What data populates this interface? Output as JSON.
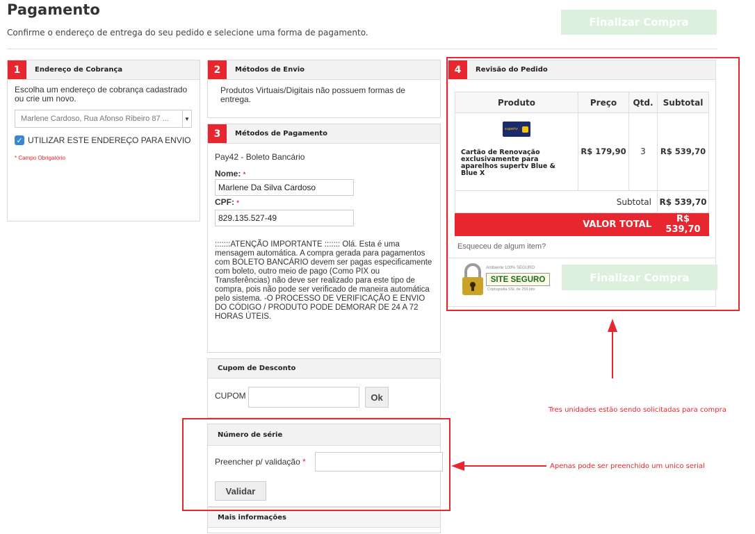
{
  "page": {
    "title": "Pagamento",
    "subtitle": "Confirme o endereço de entrega do seu pedido e selecione uma forma de pagamento.",
    "finalize_label": "Finalizar Compra"
  },
  "billing": {
    "number": "1",
    "title": "Endereço de Cobrança",
    "instructions": "Escolha um endereço de cobrança cadastrado ou crie um novo.",
    "selected_address": "Marlene Cardoso, Rua Afonso Ribeiro 87 ...",
    "use_for_shipping_label": "UTILIZAR ESTE ENDEREÇO PARA ENVIO",
    "use_for_shipping_checked": true,
    "required_note": "* Campo Obrigatório"
  },
  "shipping": {
    "number": "2",
    "title": "Métodos de Envio",
    "message": "Produtos Virtuais/Digitais não possuem formas de entrega."
  },
  "payment": {
    "number": "3",
    "title": "Métodos de Pagamento",
    "method": "Pay42 - Boleto Bancário",
    "name_label": "Nome:",
    "name_value": "Marlene Da Silva Cardoso",
    "cpf_label": "CPF:",
    "cpf_value": "829.135.527-49",
    "required_mark": "*",
    "notice": ":::::::ATENÇÃO IMPORTANTE ::::::: Olá. Esta é uma mensagem automática. A compra gerada para pagamentos com BOLETO BANCÁRIO devem ser pagas especificamente com boleto, outro meio de pago (Como PIX ou Transferências) não deve ser realizado para este tipo de compra, pois não pode ser verificado de maneira automática pelo sistema. -O PROCESSO DE VERIFICAÇÃO E ENVIO DO CÓDIGO / PRODUTO PODE DEMORAR DE 24 A 72 HORAS ÚTEIS."
  },
  "coupon": {
    "title": "Cupom de Desconto",
    "label": "CUPOM",
    "value": "",
    "ok_label": "Ok"
  },
  "serial": {
    "title": "Número de série",
    "label": "Preencher p/ validação",
    "required_mark": "*",
    "value": "",
    "validate_label": "Validar"
  },
  "more_info": {
    "title": "Mais informações"
  },
  "review": {
    "number": "4",
    "title": "Revisão do Pedido",
    "columns": [
      "Produto",
      "Preço",
      "Qtd.",
      "Subtotal"
    ],
    "items": [
      {
        "name": "Cartão de Renovação exclusivamente para aparelhos supertv Blue & Blue X",
        "price": "R$ 179,90",
        "qty": "3",
        "subtotal": "R$ 539,70",
        "thumb_text": "supertv"
      }
    ],
    "subtotal_label": "Subtotal",
    "subtotal_value": "R$ 539,70",
    "total_label": "VALOR TOTAL",
    "total_value": "R$ 539,70",
    "forgot_link": "Esqueceu de algum item?",
    "seal_top": "Ambiente 100% SEGURO",
    "seal_main": "SITE SEGURO",
    "seal_bottom": "Criptografia SSL de 256 bits"
  },
  "annotations": {
    "qty_note": "Tres unidades estão sendo solicitadas para compra",
    "serial_note": "Apenas pode ser preenchido um unico serial"
  },
  "colors": {
    "accent_red": "#e8262f",
    "finalize_green": "#dcf0dd",
    "seal_gold": "#c9a227"
  }
}
